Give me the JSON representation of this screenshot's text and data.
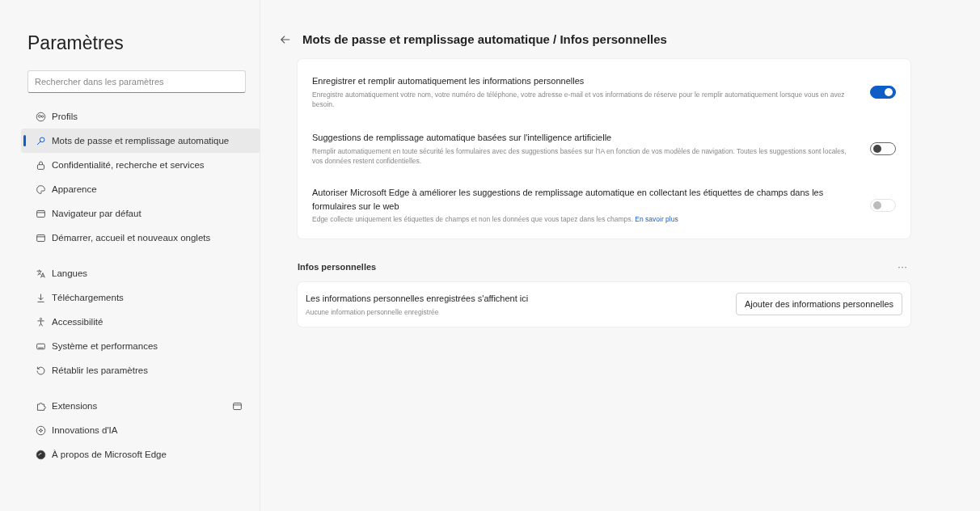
{
  "sidebar": {
    "title": "Paramètres",
    "search": {
      "placeholder": "Rechercher dans les paramètres"
    },
    "groups": [
      {
        "items": [
          {
            "label": "Profils",
            "selected": false
          },
          {
            "label": "Mots de passe et remplissage automatique",
            "selected": true
          },
          {
            "label": "Confidentialité, recherche et services",
            "selected": false
          },
          {
            "label": "Apparence",
            "selected": false
          },
          {
            "label": "Navigateur par défaut",
            "selected": false
          },
          {
            "label": "Démarrer, accueil et nouveaux onglets",
            "selected": false
          }
        ]
      },
      {
        "items": [
          {
            "label": "Langues",
            "selected": false
          },
          {
            "label": "Téléchargements",
            "selected": false
          },
          {
            "label": "Accessibilité",
            "selected": false
          },
          {
            "label": "Système et performances",
            "selected": false
          },
          {
            "label": "Rétablir les paramètres",
            "selected": false
          }
        ]
      },
      {
        "items": [
          {
            "label": "Extensions",
            "selected": false,
            "external": true
          },
          {
            "label": "Innovations d'IA",
            "selected": false
          },
          {
            "label": "À propos de Microsoft Edge",
            "selected": false
          }
        ]
      }
    ]
  },
  "main": {
    "title": "Mots de passe et remplissage automatique / Infos personnelles",
    "settings": [
      {
        "kind": "toggle",
        "title": "Enregistrer et remplir automatiquement les informations personnelles",
        "description": "Enregistre automatiquement votre nom, votre numéro de téléphone, votre adresse e-mail et vos informations de réserve pour le remplir automatiquement lorsque vous en avez besoin.",
        "on": true,
        "disabled": false
      },
      {
        "kind": "toggle",
        "title": "Suggestions de remplissage automatique basées sur l'intelligence artificielle",
        "description": "Remplir automatiquement en toute sécurité les formulaires avec des suggestions basées sur l'IA en fonction de vos modèles de navigation. Toutes les suggestions sont locales, vos données restent confidentielles.",
        "on": false,
        "disabled": false
      },
      {
        "kind": "toggle",
        "title": "Autoriser Microsoft Edge à améliorer les suggestions de remplissage automatique en collectant les étiquettes de champs dans les formulaires sur le web",
        "description": "Edge collecte uniquement les étiquettes de champs et non les données que vous tapez dans les champs.",
        "link": "En savoir plus",
        "on": false,
        "disabled": true
      }
    ],
    "section": {
      "title": "Infos personnelles",
      "more": "···",
      "empty_title": "Les informations personnelles enregistrées s'affichent ici",
      "empty_subtitle": "Aucune information personnelle enregistrée",
      "button": "Ajouter des informations personnelles"
    }
  }
}
